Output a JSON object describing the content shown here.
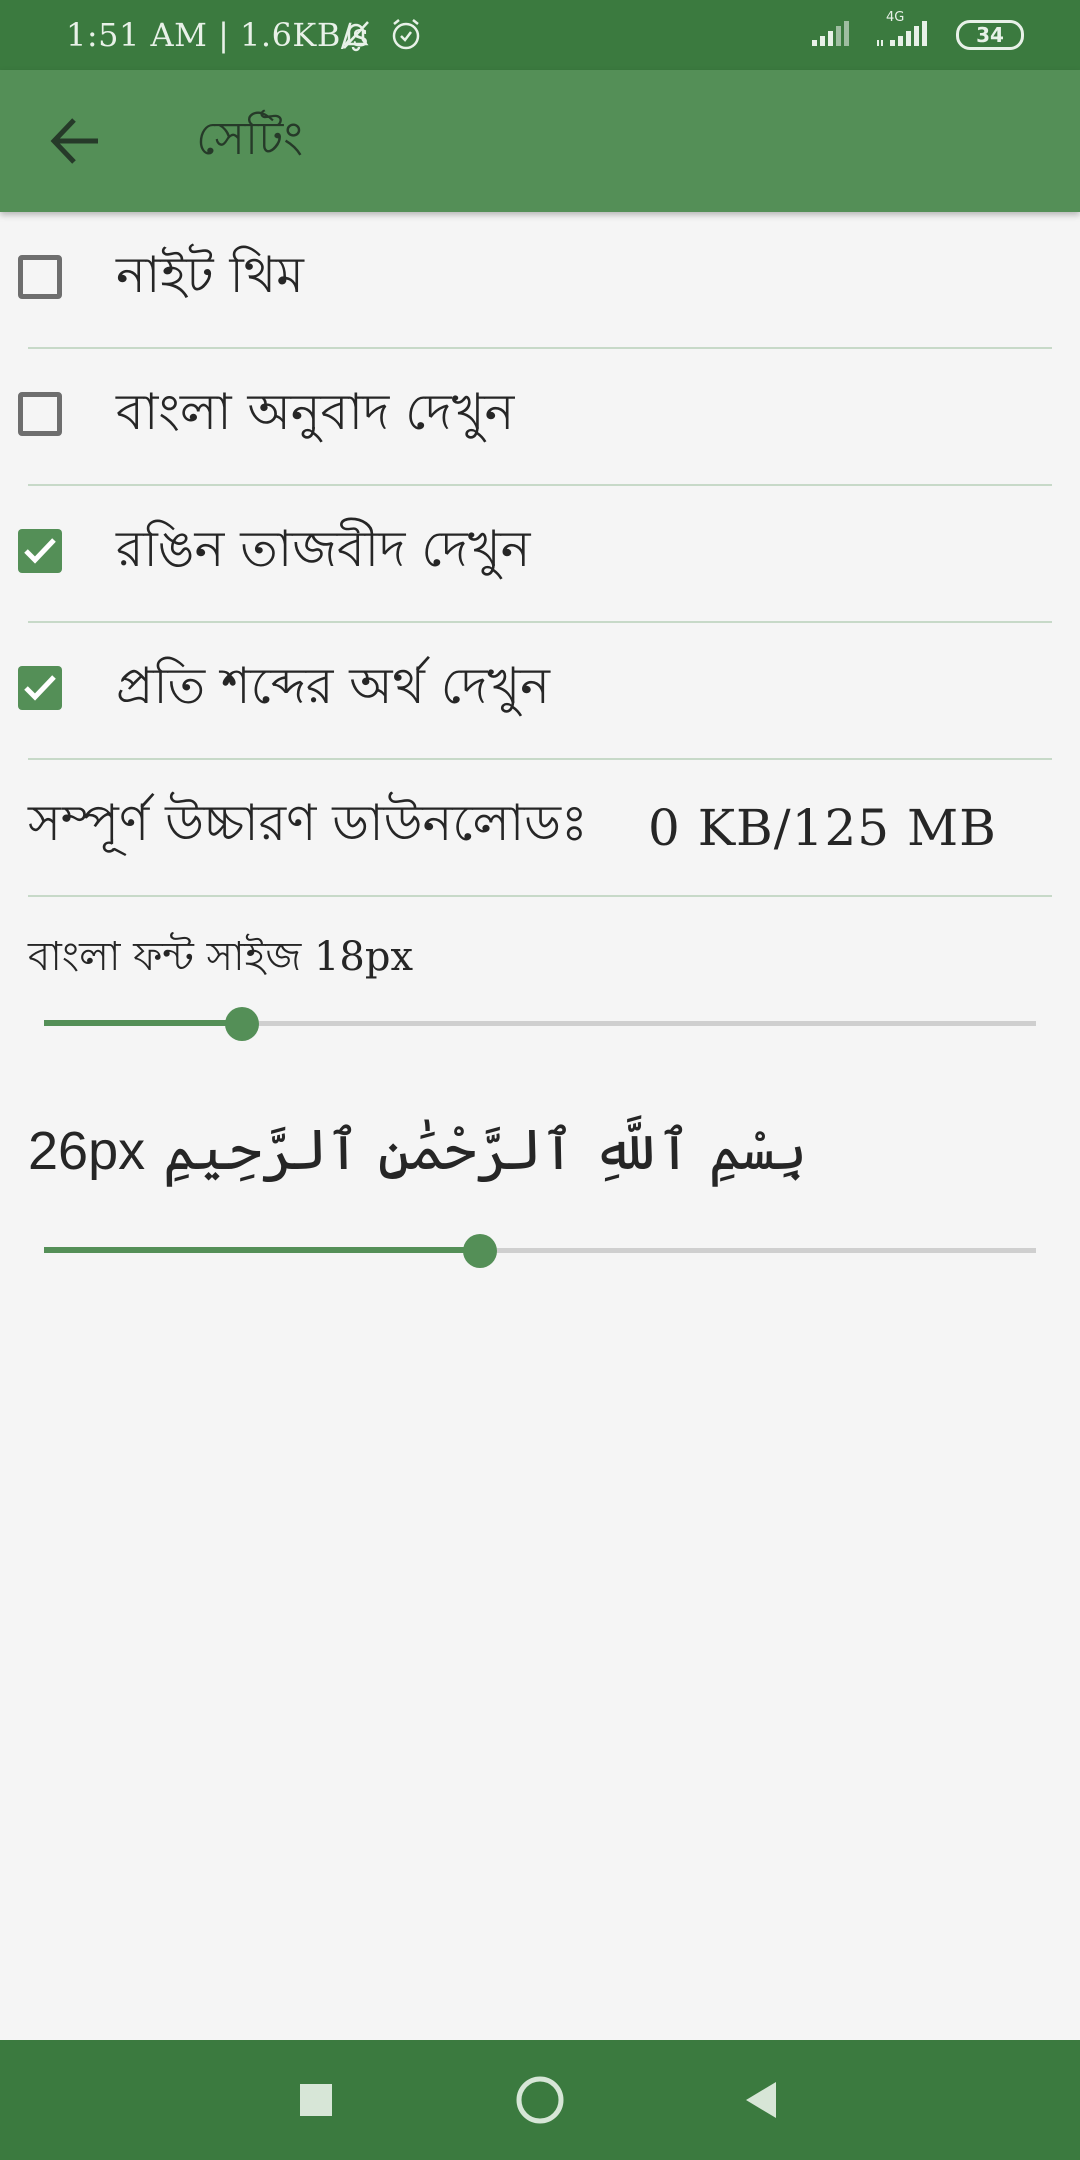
{
  "status_bar": {
    "text": "1:51 AM | 1.6KB/s",
    "network_label": "4G",
    "battery": "34",
    "icons": [
      "notifications-off-icon",
      "alarm-icon",
      "signal-icon",
      "signal-4g-icon"
    ]
  },
  "app_bar": {
    "title": "সেটিং",
    "back_icon": "arrow-back-icon"
  },
  "settings": [
    {
      "label": "নাইট থিম",
      "checked": false
    },
    {
      "label": "বাংলা অনুবাদ দেখুন",
      "checked": false
    },
    {
      "label": "রঙিন তাজবীদ দেখুন",
      "checked": true
    },
    {
      "label": "প্রতি শব্দের অর্থ দেখুন",
      "checked": true
    }
  ],
  "download": {
    "label": "সম্পূর্ণ উচ্চারণ ডাউনলোডঃ",
    "value": "0 KB/125 MB"
  },
  "bangla_font": {
    "label": "বাংলা ফন্ট সাইজ",
    "size": "18px",
    "slider_fraction": 0.2
  },
  "arabic_font": {
    "size": "26px",
    "sample": "بِسْمِ ٱللَّهِ ٱلرَّحْمَٰنِ ٱلرَّحِيمِ",
    "slider_fraction": 0.44
  },
  "colors": {
    "primary": "#548f57",
    "primary_dark": "#3b7a3f",
    "divider": "#c7d9c8",
    "background": "#f5f5f5"
  },
  "nav_bar": {
    "icons": [
      "recents-square-icon",
      "home-circle-icon",
      "back-triangle-icon"
    ]
  }
}
